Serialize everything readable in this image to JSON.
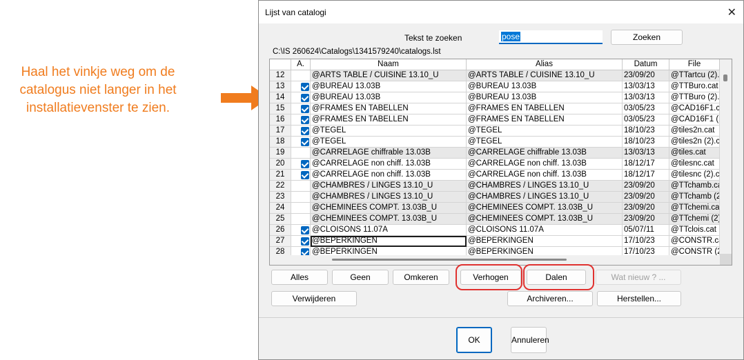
{
  "annotation": {
    "text": "Haal het vinkje weg om de catalogus niet langer in het installatievenster te zien."
  },
  "dialog": {
    "title": "Lijst van catalogi",
    "close_icon": "close-icon",
    "search_label": "Tekst te zoeken",
    "search_value": "pose",
    "search_button": "Zoeken",
    "path": "C:\\IS 260624\\Catalogs\\1341579240\\catalogs.lst"
  },
  "table": {
    "columns": [
      "",
      "A.",
      "Naam",
      "Alias",
      "Datum",
      "File"
    ],
    "rows": [
      {
        "num": "12",
        "checked": false,
        "shaded": true,
        "naam": "@ARTS TABLE / CUISINE 13.10_U",
        "alias": "@ARTS TABLE / CUISINE 13.10_U",
        "datum": "23/09/20",
        "file": "@TTartcu (2).c"
      },
      {
        "num": "13",
        "checked": true,
        "shaded": false,
        "naam": "@BUREAU 13.03B",
        "alias": "@BUREAU 13.03B",
        "datum": "13/03/13",
        "file": "@TTBuro.cat"
      },
      {
        "num": "14",
        "checked": true,
        "shaded": false,
        "naam": "@BUREAU 13.03B",
        "alias": "@BUREAU 13.03B",
        "datum": "13/03/13",
        "file": "@TTBuro (2).c"
      },
      {
        "num": "15",
        "checked": true,
        "shaded": false,
        "naam": "@FRAMES EN TABELLEN",
        "alias": "@FRAMES EN TABELLEN",
        "datum": "03/05/23",
        "file": "@CAD16F1.cat"
      },
      {
        "num": "16",
        "checked": true,
        "shaded": false,
        "naam": "@FRAMES EN TABELLEN",
        "alias": "@FRAMES EN TABELLEN",
        "datum": "03/05/23",
        "file": "@CAD16F1 (2)"
      },
      {
        "num": "17",
        "checked": true,
        "shaded": false,
        "naam": "@TEGEL",
        "alias": "@TEGEL",
        "datum": "18/10/23",
        "file": "@tiles2n.cat"
      },
      {
        "num": "18",
        "checked": true,
        "shaded": false,
        "naam": "@TEGEL",
        "alias": "@TEGEL",
        "datum": "18/10/23",
        "file": "@tiles2n (2).c"
      },
      {
        "num": "19",
        "checked": false,
        "shaded": true,
        "naam": "@CARRELAGE chiffrable 13.03B",
        "alias": "@CARRELAGE chiffrable 13.03B",
        "datum": "13/03/13",
        "file": "@tiles.cat"
      },
      {
        "num": "20",
        "checked": true,
        "shaded": false,
        "naam": "@CARRELAGE non chiff. 13.03B",
        "alias": "@CARRELAGE non chiff. 13.03B",
        "datum": "18/12/17",
        "file": "@tilesnc.cat"
      },
      {
        "num": "21",
        "checked": true,
        "shaded": false,
        "naam": "@CARRELAGE non chiff. 13.03B",
        "alias": "@CARRELAGE non chiff. 13.03B",
        "datum": "18/12/17",
        "file": "@tilesnc (2).ca"
      },
      {
        "num": "22",
        "checked": false,
        "shaded": true,
        "naam": "@CHAMBRES / LINGES 13.10_U",
        "alias": "@CHAMBRES / LINGES 13.10_U",
        "datum": "23/09/20",
        "file": "@TTchamb.cat"
      },
      {
        "num": "23",
        "checked": false,
        "shaded": true,
        "naam": "@CHAMBRES / LINGES 13.10_U",
        "alias": "@CHAMBRES / LINGES 13.10_U",
        "datum": "23/09/20",
        "file": "@TTchamb (2)"
      },
      {
        "num": "24",
        "checked": false,
        "shaded": true,
        "naam": "@CHEMINEES COMPT. 13.03B_U",
        "alias": "@CHEMINEES COMPT. 13.03B_U",
        "datum": "23/09/20",
        "file": "@TTchemi.cat"
      },
      {
        "num": "25",
        "checked": false,
        "shaded": true,
        "naam": "@CHEMINEES COMPT. 13.03B_U",
        "alias": "@CHEMINEES COMPT. 13.03B_U",
        "datum": "23/09/20",
        "file": "@TTchemi (2).c"
      },
      {
        "num": "26",
        "checked": true,
        "shaded": false,
        "naam": "@CLOISONS 11.07A",
        "alias": "@CLOISONS 11.07A",
        "datum": "05/07/11",
        "file": "@TTclois.cat"
      },
      {
        "num": "27",
        "checked": true,
        "shaded": false,
        "focused": true,
        "naam": "@BEPERKINGEN",
        "alias": "@BEPERKINGEN",
        "datum": "17/10/23",
        "file": "@CONSTR.cat"
      },
      {
        "num": "28",
        "checked": true,
        "shaded": false,
        "naam": "@BEPERKINGEN",
        "alias": "@BEPERKINGEN",
        "datum": "17/10/23",
        "file": "@CONSTR (2)"
      }
    ]
  },
  "buttons": {
    "all": "Alles",
    "none": "Geen",
    "invert": "Omkeren",
    "raise": "Verhogen",
    "lower": "Dalen",
    "whats_new": "Wat nieuw ? ...",
    "delete": "Verwijderen",
    "archive": "Archiveren...",
    "restore": "Herstellen...",
    "ok": "OK",
    "cancel": "Annuleren"
  },
  "colors": {
    "annotation": "#f07c1e",
    "highlight": "#e0312f",
    "accent": "#0067c0"
  }
}
